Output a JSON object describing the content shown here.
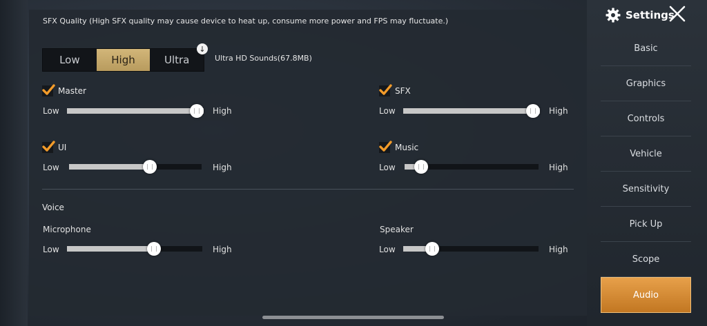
{
  "audio": {
    "sfx_quality_title": "SFX Quality (High SFX quality may cause device to heat up, consume more power and FPS may fluctuate.)",
    "quality_options": [
      "Low",
      "High",
      "Ultra"
    ],
    "selected_quality": "High",
    "ultra_note": "Ultra HD Sounds(67.8MB)",
    "low_label": "Low",
    "high_label": "High",
    "channels": {
      "master": {
        "label": "Master",
        "checked": true,
        "level": 1.0
      },
      "sfx": {
        "label": "SFX",
        "checked": true,
        "level": 1.0
      },
      "ui": {
        "label": "UI",
        "checked": true,
        "level": 0.62
      },
      "music": {
        "label": "Music",
        "checked": true,
        "level": 0.08
      }
    },
    "voice": {
      "title": "Voice",
      "microphone": {
        "label": "Microphone",
        "level": 0.66
      },
      "speaker": {
        "label": "Speaker",
        "level": 0.18
      }
    }
  },
  "sidebar": {
    "title": "Settings",
    "items": [
      {
        "label": "Basic"
      },
      {
        "label": "Graphics"
      },
      {
        "label": "Controls"
      },
      {
        "label": "Vehicle"
      },
      {
        "label": "Sensitivity"
      },
      {
        "label": "Pick Up"
      },
      {
        "label": "Scope"
      },
      {
        "label": "Audio"
      }
    ],
    "active": "Audio"
  },
  "colors": {
    "accent_gold": "#c9ad6d",
    "active_tab": "#d98c36",
    "check_orange": "#f29b2a"
  },
  "icons": {
    "settings": "gear-icon",
    "close": "close-icon",
    "download": "download-icon",
    "check": "checkmark-icon"
  }
}
